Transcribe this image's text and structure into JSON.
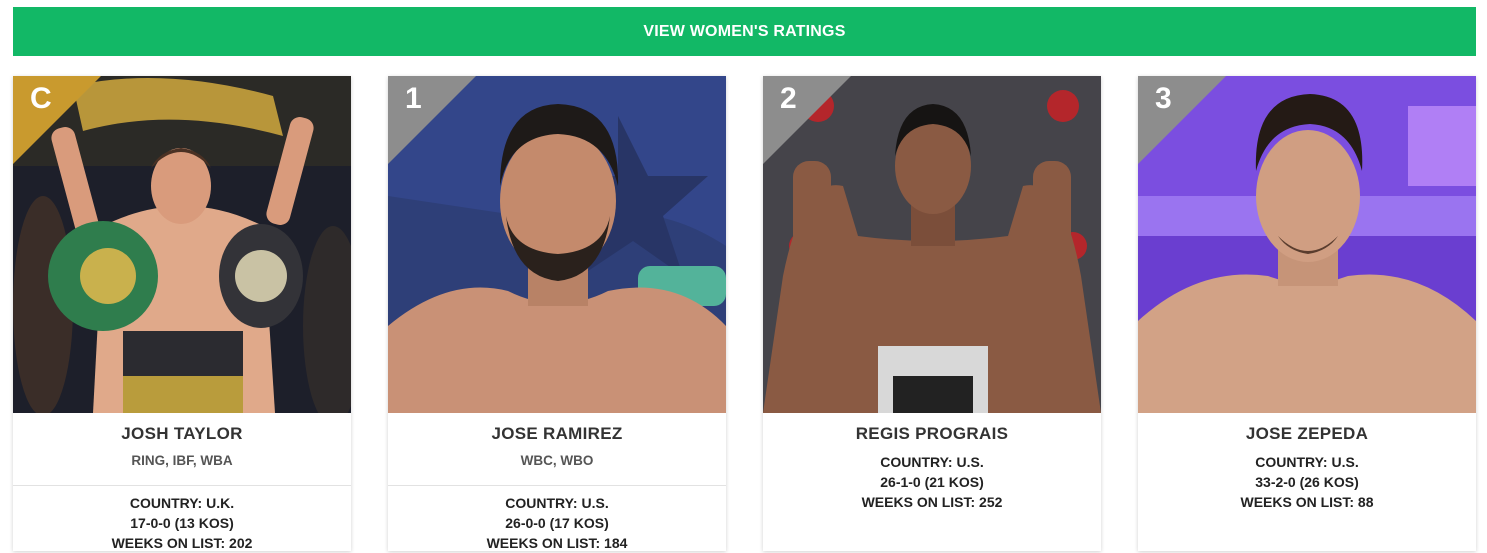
{
  "banner": {
    "label": "VIEW WOMEN'S RATINGS"
  },
  "colors": {
    "accent": "#12b866",
    "champion_corner": "#c99a2e",
    "rank_corner": "#8d8d8d"
  },
  "fighters": [
    {
      "rank": "C",
      "name": "JOSH TAYLOR",
      "belts": "RING, IBF, WBA",
      "country": "COUNTRY: U.K.",
      "record": "17-0-0 (13 KOS)",
      "weeks": "WEEKS ON LIST: 202"
    },
    {
      "rank": "1",
      "name": "JOSE RAMIREZ",
      "belts": "WBC, WBO",
      "country": "COUNTRY: U.S.",
      "record": "26-0-0 (17 KOS)",
      "weeks": "WEEKS ON LIST: 184"
    },
    {
      "rank": "2",
      "name": "REGIS PROGRAIS",
      "country": "COUNTRY: U.S.",
      "record": "26-1-0 (21 KOS)",
      "weeks": "WEEKS ON LIST: 252"
    },
    {
      "rank": "3",
      "name": "JOSE ZEPEDA",
      "country": "COUNTRY: U.S.",
      "record": "33-2-0 (26 KOS)",
      "weeks": "WEEKS ON LIST: 88"
    }
  ]
}
